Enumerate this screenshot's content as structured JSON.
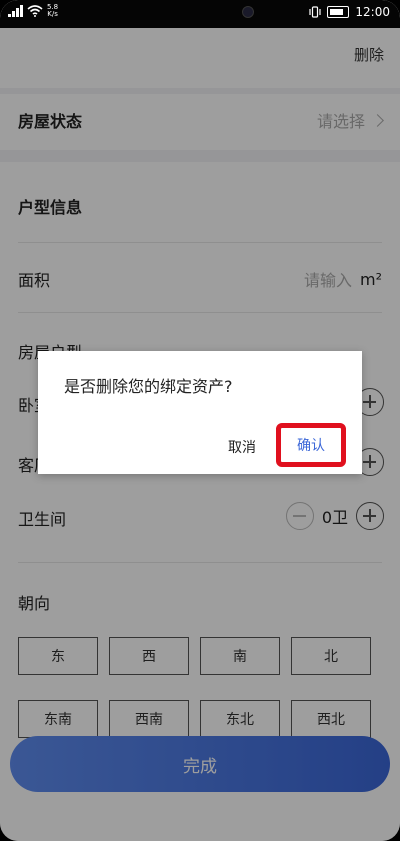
{
  "status_bar": {
    "speed_value": "5.8",
    "speed_unit": "K/s",
    "time": "12:00"
  },
  "header": {
    "delete_label": "删除"
  },
  "house_status": {
    "label": "房屋状态",
    "value_placeholder": "请选择"
  },
  "layout_info": {
    "title": "户型信息"
  },
  "area": {
    "label": "面积",
    "placeholder": "请输入",
    "unit": "m²"
  },
  "house_type": {
    "label": "房屋户型",
    "bedroom": {
      "label": "卧室"
    },
    "living": {
      "label": "客厅"
    },
    "bathroom": {
      "label": "卫生间",
      "value": "0卫"
    }
  },
  "orientation": {
    "label": "朝向",
    "options": [
      "东",
      "西",
      "南",
      "北",
      "东南",
      "西南",
      "东北",
      "西北"
    ]
  },
  "done_label": "完成",
  "dialog": {
    "message": "是否删除您的绑定资产?",
    "cancel_label": "取消",
    "confirm_label": "确认"
  },
  "colors": {
    "accent": "#3b67d8",
    "highlight": "#e0101e"
  }
}
